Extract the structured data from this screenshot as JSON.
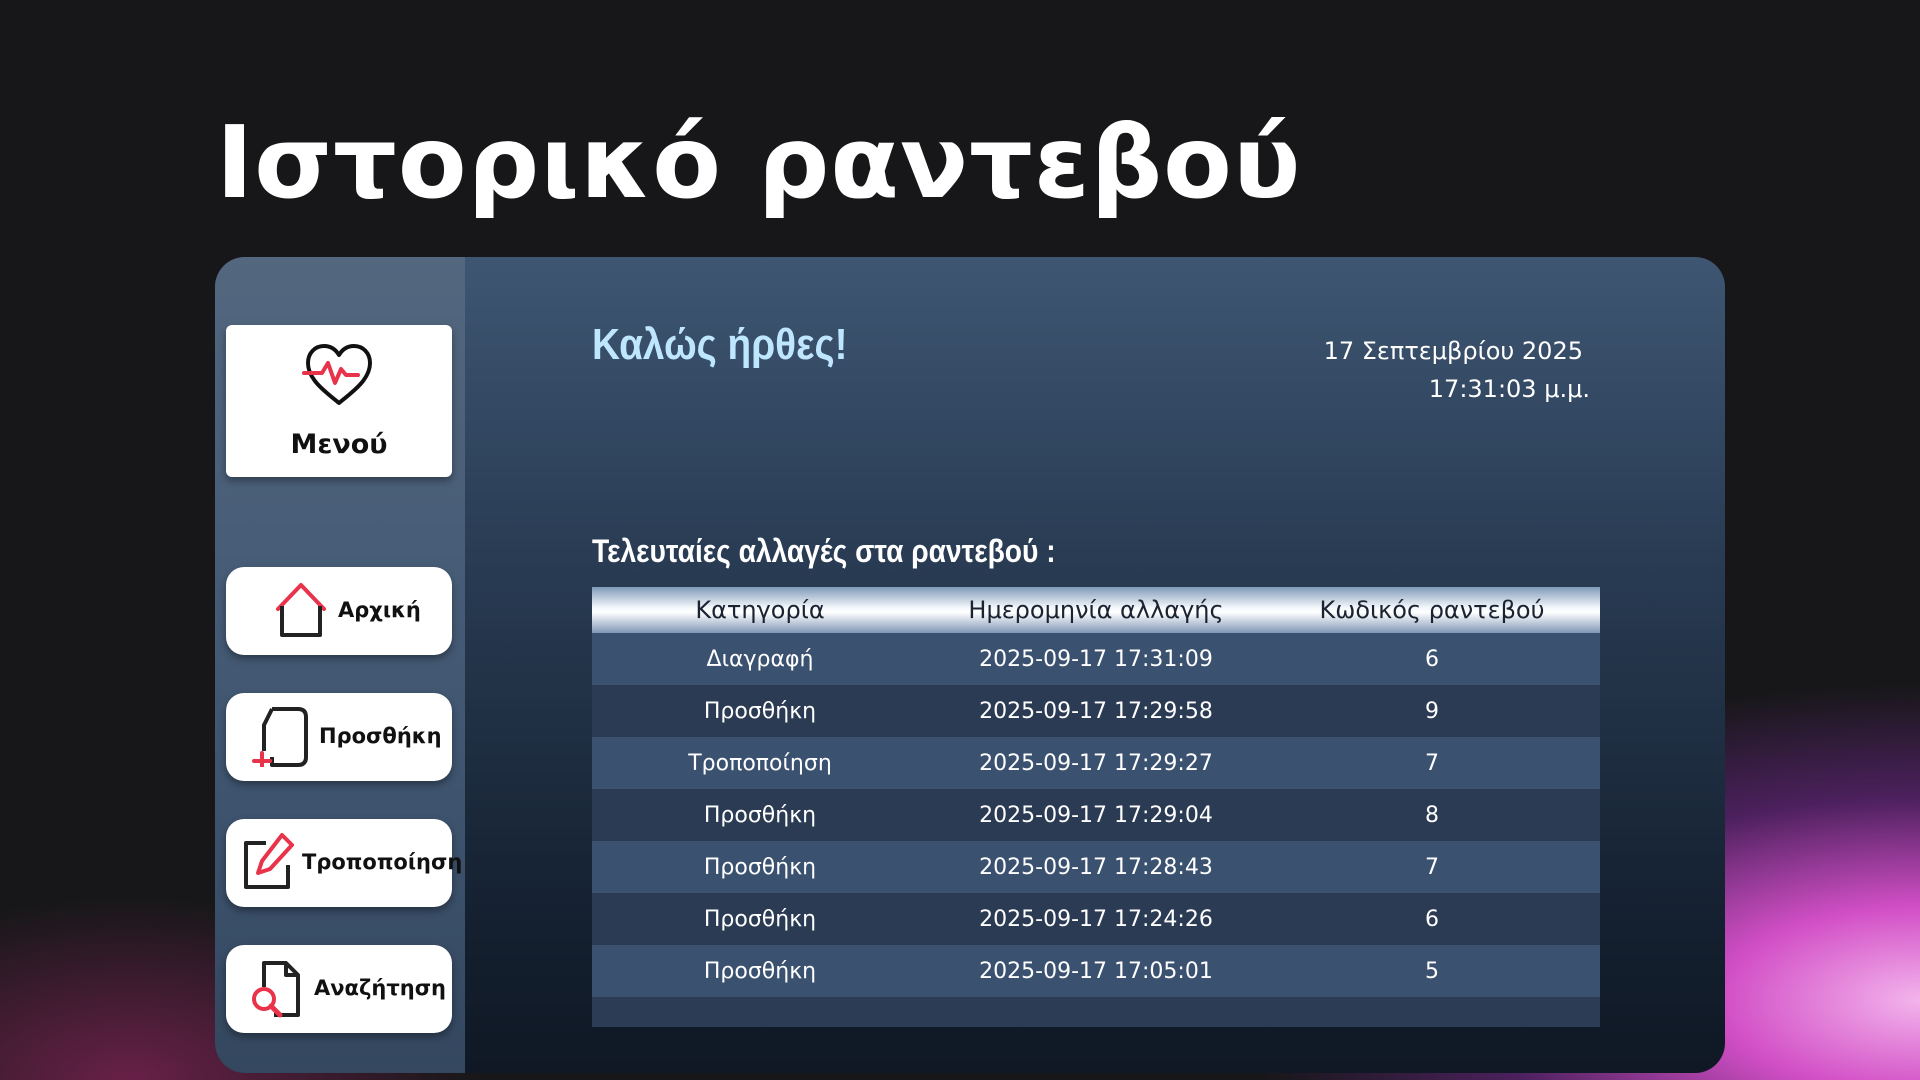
{
  "page_title": "Ιστορικό ραντεβού",
  "sidebar": {
    "menu_label": "Μενού",
    "items": [
      {
        "label": "Αρχική"
      },
      {
        "label": "Προσθήκη"
      },
      {
        "label": "Τροποποίηση"
      },
      {
        "label": "Αναζήτηση"
      }
    ]
  },
  "header": {
    "welcome": "Καλώς ήρθες!",
    "date": "17 Σεπτεμβρίου 2025",
    "time": "17:31:03 μ.μ."
  },
  "changes": {
    "heading": "Τελευταίες αλλαγές στα ραντεβού :",
    "columns": [
      "Κατηγορία",
      "Ημερομηνία αλλαγής",
      "Κωδικός ραντεβού"
    ],
    "rows": [
      [
        "Διαγραφή",
        "2025-09-17 17:31:09",
        "6"
      ],
      [
        "Προσθήκη",
        "2025-09-17 17:29:58",
        "9"
      ],
      [
        "Τροποποίηση",
        "2025-09-17 17:29:27",
        "7"
      ],
      [
        "Προσθήκη",
        "2025-09-17 17:29:04",
        "8"
      ],
      [
        "Προσθήκη",
        "2025-09-17 17:28:43",
        "7"
      ],
      [
        "Προσθήκη",
        "2025-09-17 17:24:26",
        "6"
      ],
      [
        "Προσθήκη",
        "2025-09-17 17:05:01",
        "5"
      ]
    ]
  },
  "colors": {
    "accent_red": "#e8334a",
    "welcome_text": "#bfe6ff"
  }
}
